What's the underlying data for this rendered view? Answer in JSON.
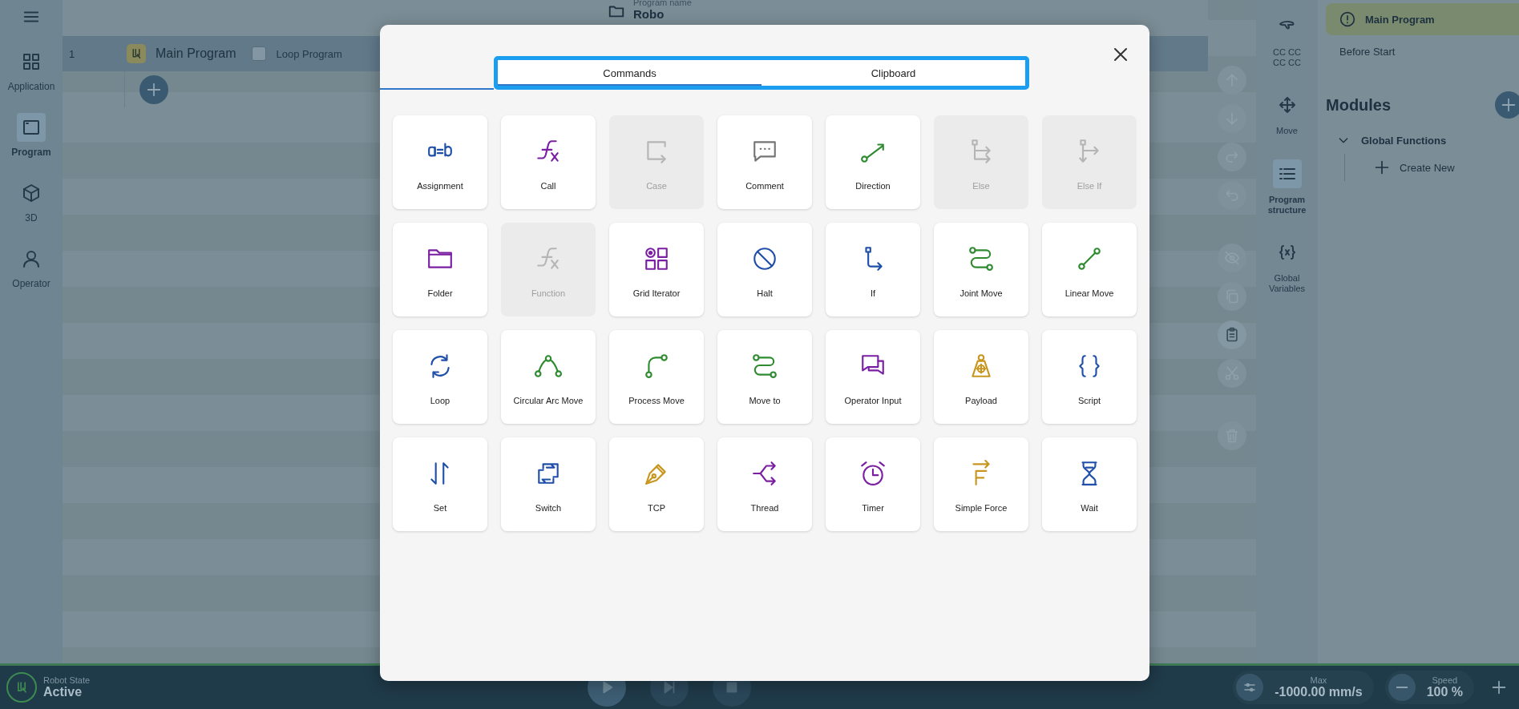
{
  "nav": {
    "items": [
      {
        "label": "Application",
        "kind": "apps",
        "selected": false
      },
      {
        "label": "Program",
        "kind": "program",
        "selected": true
      },
      {
        "label": "3D",
        "kind": "cube",
        "selected": false
      },
      {
        "label": "Operator",
        "kind": "person",
        "selected": false
      }
    ]
  },
  "header": {
    "caption": "Program name",
    "name": "Robo"
  },
  "program_tree": {
    "line": "1",
    "title": "Main Program",
    "loop_label": "Loop Program",
    "loop_checked": false
  },
  "edit_tools": [
    {
      "kind": "up",
      "disabled": true
    },
    {
      "kind": "down",
      "disabled": true
    },
    {
      "kind": "redo",
      "disabled": true
    },
    {
      "kind": "undo",
      "disabled": true
    },
    {
      "kind": "hide",
      "disabled": true
    },
    {
      "kind": "copy",
      "disabled": true
    },
    {
      "kind": "paste",
      "disabled": false
    },
    {
      "kind": "cut",
      "disabled": true
    },
    {
      "kind": "delete",
      "disabled": true
    }
  ],
  "tool_panel": [
    {
      "label": "CC CC CC CC",
      "kind": "gripper",
      "selected": false
    },
    {
      "label": "Move",
      "kind": "move",
      "selected": false
    },
    {
      "label": "Program structure",
      "kind": "structure",
      "selected": true
    },
    {
      "label": "Global Variables",
      "kind": "variables",
      "selected": false
    }
  ],
  "structure": {
    "programs": [
      {
        "label": "Main Program",
        "selected": true,
        "warning": true
      },
      {
        "label": "Before Start",
        "selected": false,
        "warning": false
      }
    ],
    "modules_title": "Modules",
    "groups": [
      {
        "label": "Global Functions",
        "expanded": true,
        "children": [
          {
            "label": "Create New"
          }
        ]
      }
    ]
  },
  "dialog": {
    "tabs": [
      {
        "label": "Commands",
        "selected": true
      },
      {
        "label": "Clipboard",
        "selected": false
      }
    ],
    "commands": [
      {
        "label": "Assignment",
        "kind": "assignment",
        "color": "#1f4fa8",
        "disabled": false
      },
      {
        "label": "Call",
        "kind": "call",
        "color": "#7b1fa2",
        "disabled": false
      },
      {
        "label": "Case",
        "kind": "case",
        "disabled": true
      },
      {
        "label": "Comment",
        "kind": "comment",
        "color": "#757575",
        "disabled": false
      },
      {
        "label": "Direction",
        "kind": "direction",
        "color": "#2e8b30",
        "disabled": false
      },
      {
        "label": "Else",
        "kind": "else",
        "disabled": true
      },
      {
        "label": "Else If",
        "kind": "elseif",
        "disabled": true
      },
      {
        "label": "Folder",
        "kind": "folder",
        "color": "#7b1fa2",
        "disabled": false
      },
      {
        "label": "Function",
        "kind": "call",
        "disabled": true
      },
      {
        "label": "Grid Iterator",
        "kind": "grid",
        "color": "#7b1fa2",
        "disabled": false
      },
      {
        "label": "Halt",
        "kind": "halt",
        "color": "#1f4fa8",
        "disabled": false
      },
      {
        "label": "If",
        "kind": "if",
        "color": "#1f4fa8",
        "disabled": false
      },
      {
        "label": "Joint Move",
        "kind": "jointmove",
        "color": "#2e8b30",
        "disabled": false
      },
      {
        "label": "Linear Move",
        "kind": "linearmove",
        "color": "#2e8b30",
        "disabled": false
      },
      {
        "label": "Loop",
        "kind": "loop",
        "color": "#1f4fa8",
        "disabled": false
      },
      {
        "label": "Circular Arc Move",
        "kind": "arcmove",
        "color": "#2e8b30",
        "disabled": false
      },
      {
        "label": "Process Move",
        "kind": "processmove",
        "color": "#2e8b30",
        "disabled": false
      },
      {
        "label": "Move to",
        "kind": "jointmove",
        "color": "#2e8b30",
        "disabled": false
      },
      {
        "label": "Operator Input",
        "kind": "operatorinput",
        "color": "#7b1fa2",
        "disabled": false
      },
      {
        "label": "Payload",
        "kind": "payload",
        "color": "#c8961e",
        "disabled": false
      },
      {
        "label": "Script",
        "kind": "script",
        "color": "#1f4fa8",
        "disabled": false
      },
      {
        "label": "Set",
        "kind": "set",
        "color": "#1f4fa8",
        "disabled": false
      },
      {
        "label": "Switch",
        "kind": "switch",
        "color": "#1f4fa8",
        "disabled": false
      },
      {
        "label": "TCP",
        "kind": "tcp",
        "color": "#c8961e",
        "disabled": false
      },
      {
        "label": "Thread",
        "kind": "thread",
        "color": "#7b1fa2",
        "disabled": false
      },
      {
        "label": "Timer",
        "kind": "timer",
        "color": "#7b1fa2",
        "disabled": false
      },
      {
        "label": "Simple Force",
        "kind": "force",
        "color": "#c8961e",
        "disabled": false
      },
      {
        "label": "Wait",
        "kind": "wait",
        "color": "#1f4fa8",
        "disabled": false
      }
    ]
  },
  "status_bar": {
    "state_caption": "Robot State",
    "state": "Active",
    "max_caption": "Max",
    "max_value": "-1000.00 mm/s",
    "speed_caption": "Speed",
    "speed_value": "100 %"
  }
}
